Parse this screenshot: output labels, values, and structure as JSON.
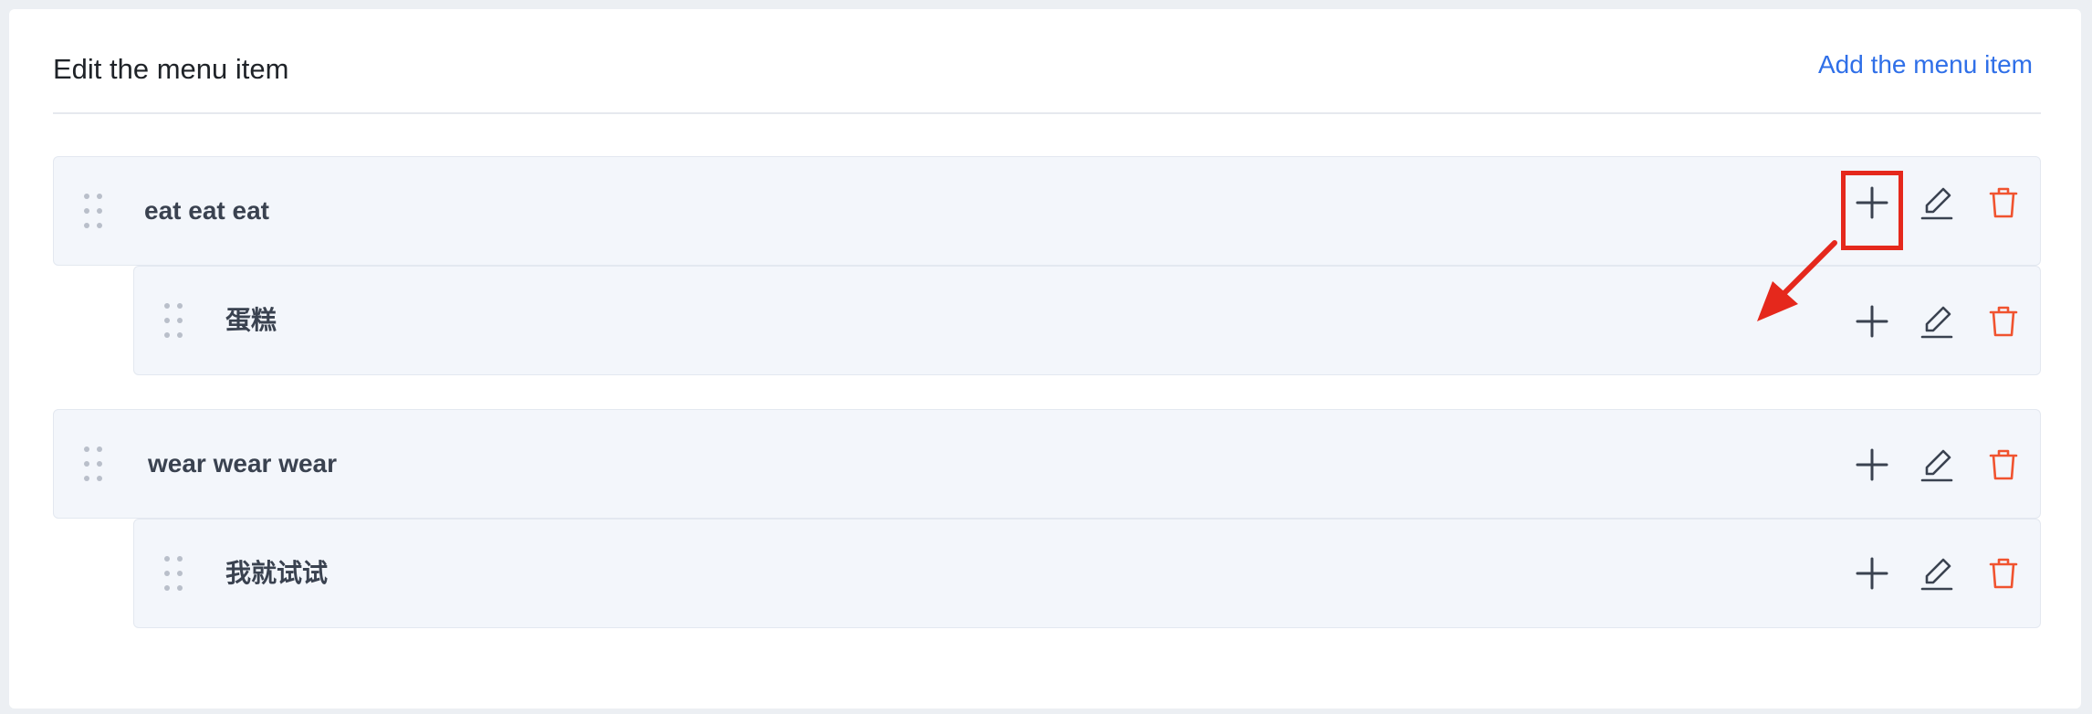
{
  "header": {
    "title": "Edit the menu item",
    "add_label": "Add the menu item"
  },
  "menu": {
    "items": [
      {
        "label": "eat eat eat",
        "level": 0
      },
      {
        "label": "蛋糕",
        "level": 1
      },
      {
        "label": "wear wear wear",
        "level": 0
      },
      {
        "label": "我就试试",
        "level": 1
      }
    ]
  },
  "icons": {
    "drag": "drag-handle-icon",
    "add": "plus-icon",
    "edit": "pencil-icon",
    "delete": "trash-icon"
  },
  "colors": {
    "accent": "#2f6fe8",
    "delete": "#f0532f",
    "icon": "#3a4250",
    "annotation": "#e5281c"
  }
}
